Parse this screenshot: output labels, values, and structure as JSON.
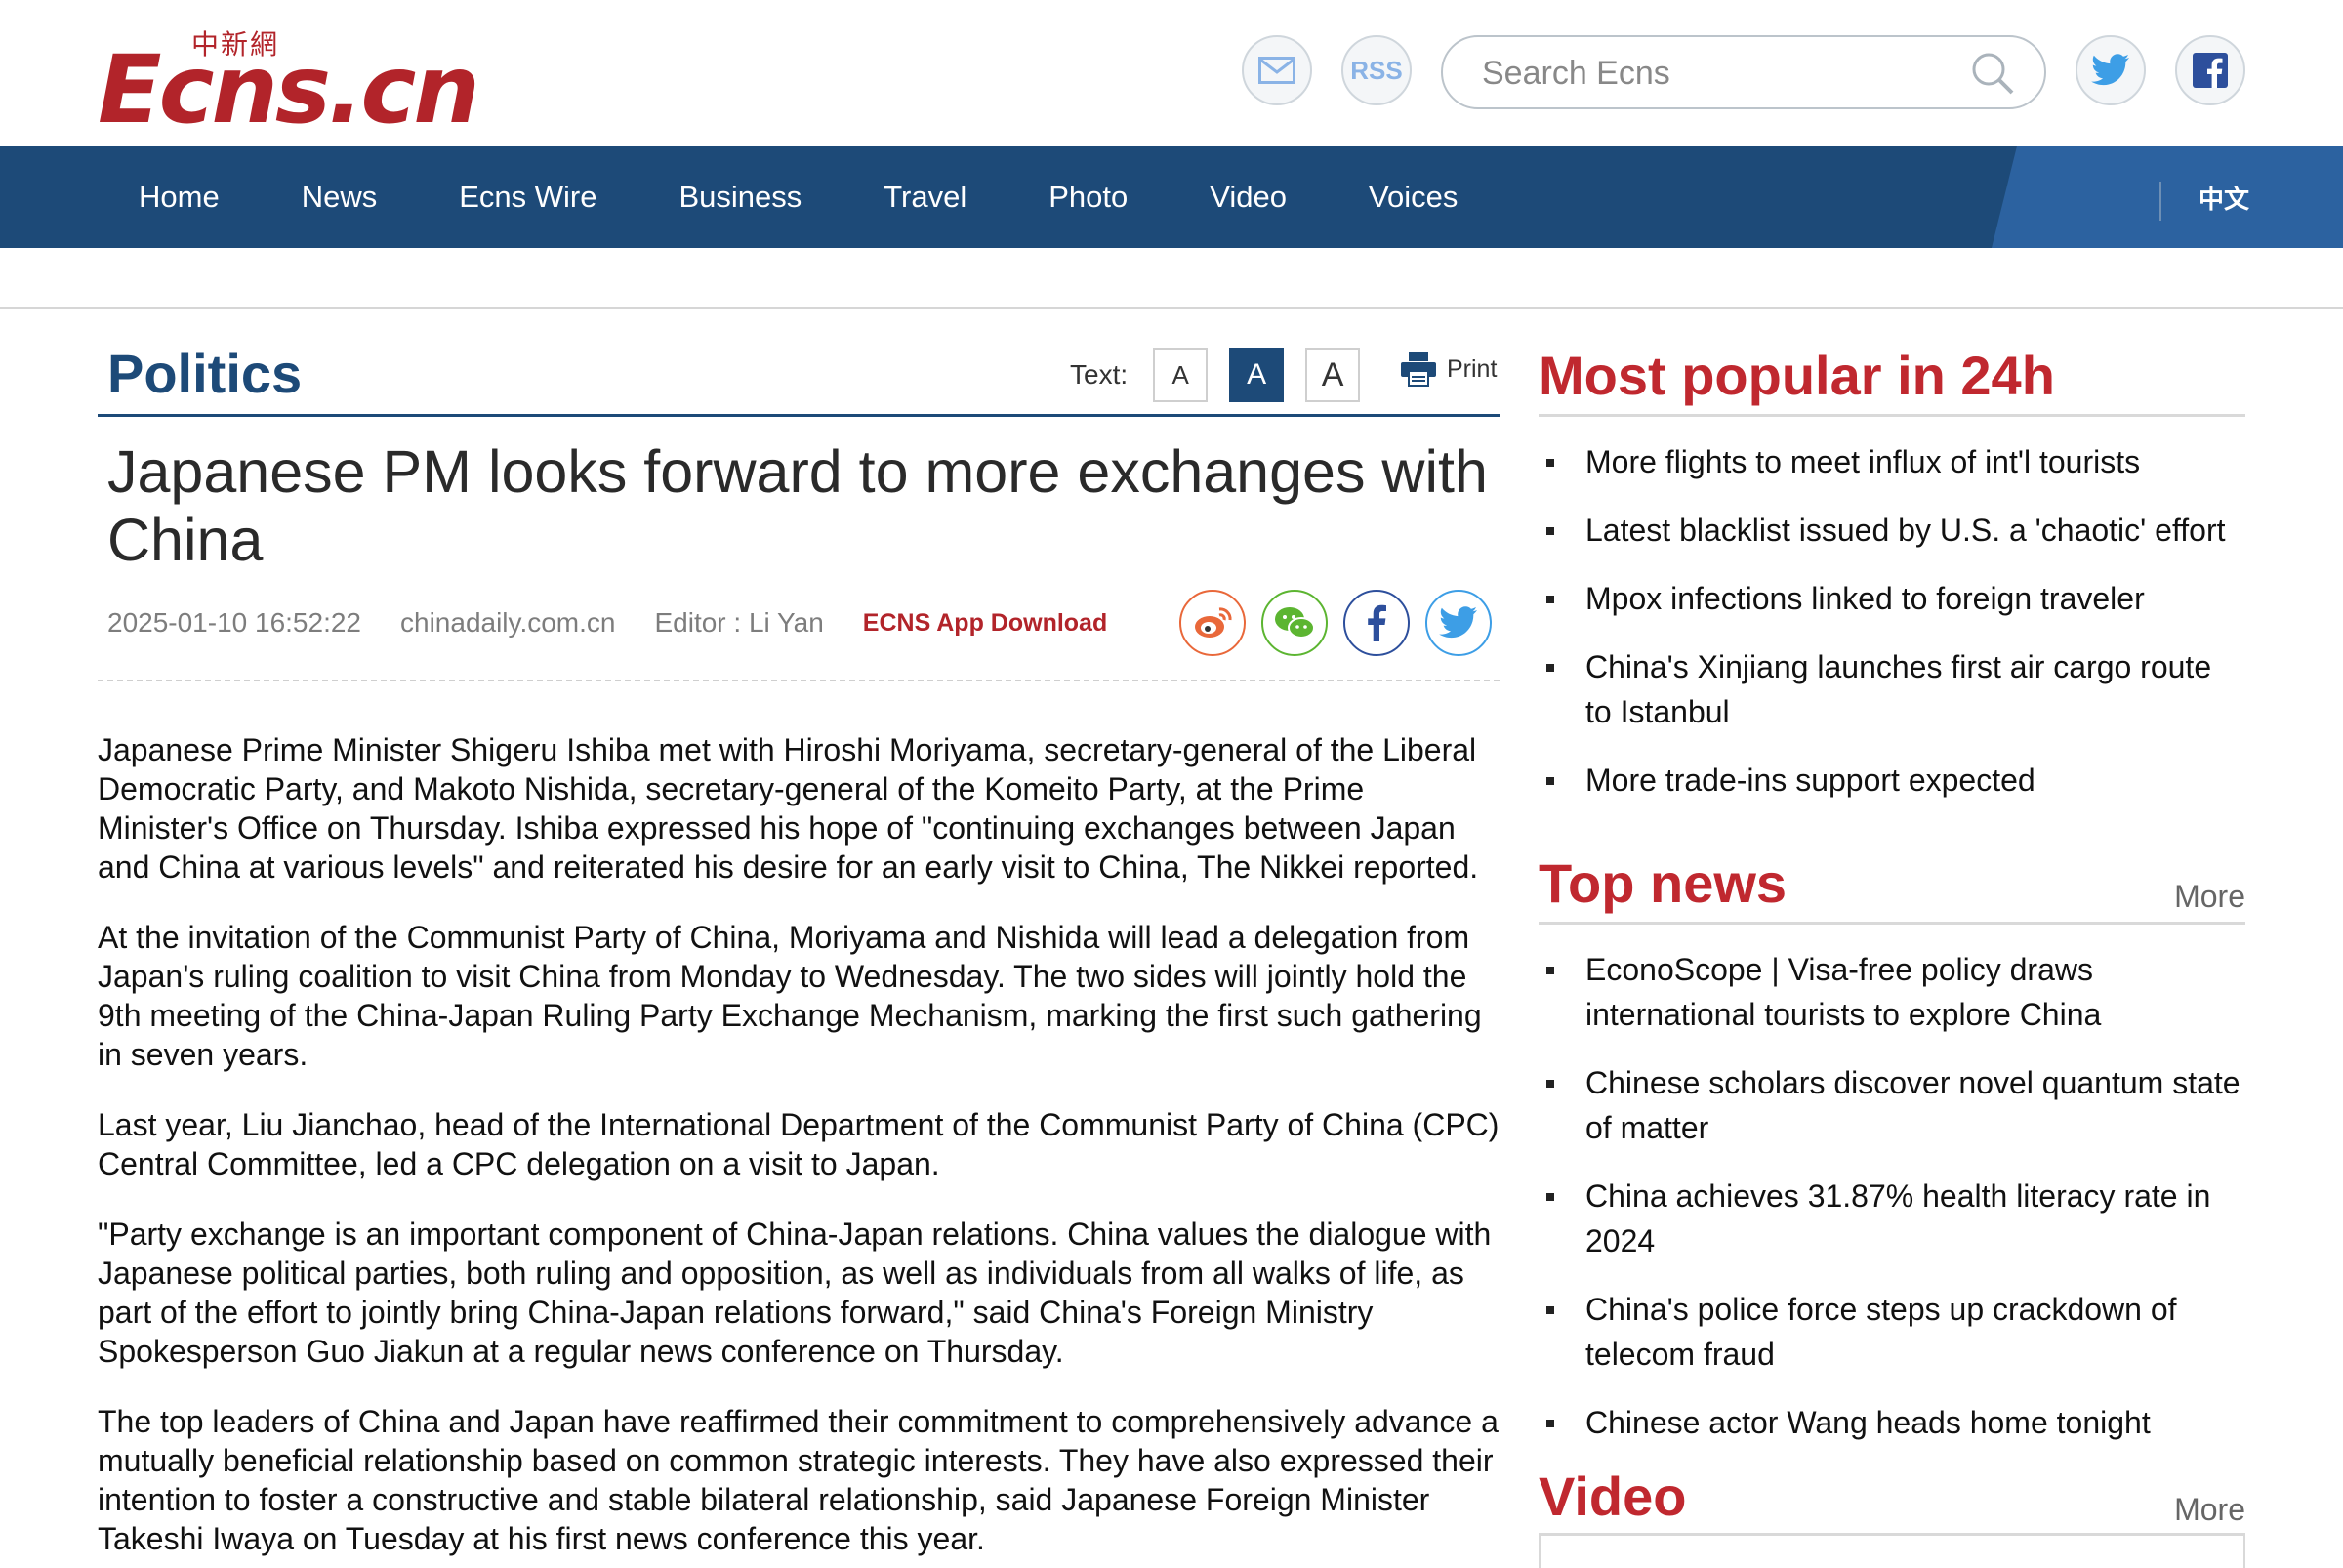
{
  "site": {
    "logo_cn": "中新網",
    "logo_text": "Ecns.cn",
    "rss_label": "RSS",
    "search_placeholder": "Search Ecns"
  },
  "nav": {
    "items": [
      "Home",
      "News",
      "Ecns Wire",
      "Business",
      "Travel",
      "Photo",
      "Video",
      "Voices"
    ],
    "lang": "中文"
  },
  "article": {
    "section": "Politics",
    "text_size_label": "Text:",
    "text_sizes": [
      "A",
      "A",
      "A"
    ],
    "active_text_size": 1,
    "print_label": "Print",
    "title": "Japanese PM looks forward to more exchanges with China",
    "date": "2025-01-10 16:52:22",
    "source": "chinadaily.com.cn",
    "editor": "Editor : Li Yan",
    "app_download": "ECNS App Download",
    "paragraphs": [
      "Japanese Prime Minister Shigeru Ishiba met with Hiroshi Moriyama, secretary-general of the Liberal Democratic Party, and Makoto Nishida, secretary-general of the Komeito Party, at the Prime Minister's Office on Thursday. Ishiba expressed his hope of \"continuing exchanges between Japan and China at various levels\" and reiterated his desire for an early visit to China, The Nikkei reported.",
      "At the invitation of the Communist Party of China, Moriyama and Nishida will lead a delegation from Japan's ruling coalition to visit China from Monday to Wednesday. The two sides will jointly hold the 9th meeting of the China-Japan Ruling Party Exchange Mechanism, marking the first such gathering in seven years.",
      "Last year, Liu Jianchao, head of the International Department of the Communist Party of China (CPC) Central Committee, led a CPC delegation on a visit to Japan.",
      "\"Party exchange is an important component of China-Japan relations. China values the dialogue with Japanese political parties, both ruling and opposition, as well as individuals from all walks of life, as part of the effort to jointly bring China-Japan relations forward,\" said China's Foreign Ministry Spokesperson Guo Jiakun at a regular news conference on Thursday.",
      "The top leaders of China and Japan have reaffirmed their commitment to comprehensively advance a mutually beneficial relationship based on common strategic interests. They have also expressed their intention to foster a constructive and stable bilateral relationship, said Japanese Foreign Minister Takeshi Iwaya on Tuesday at his first news conference this year."
    ]
  },
  "sidebar": {
    "popular": {
      "title": "Most popular in 24h",
      "items": [
        "More flights to meet influx of int'l tourists",
        "Latest blacklist issued by U.S. a 'chaotic' effort",
        "Mpox infections linked to foreign traveler",
        "China's Xinjiang launches first air cargo route to Istanbul",
        "More trade-ins support expected"
      ]
    },
    "top_news": {
      "title": "Top news",
      "more": "More",
      "items": [
        "EconoScope | Visa-free policy draws international tourists to explore China",
        "Chinese scholars discover novel quantum state of matter",
        "China achieves 31.87% health literacy rate in 2024",
        "China's police force steps up crackdown of telecom fraud",
        "Chinese actor Wang heads home tonight"
      ]
    },
    "video": {
      "title": "Video",
      "more": "More"
    }
  },
  "colors": {
    "brand_red": "#b2242a",
    "nav_blue": "#1d4a78",
    "sidebar_red": "#c0282f"
  }
}
